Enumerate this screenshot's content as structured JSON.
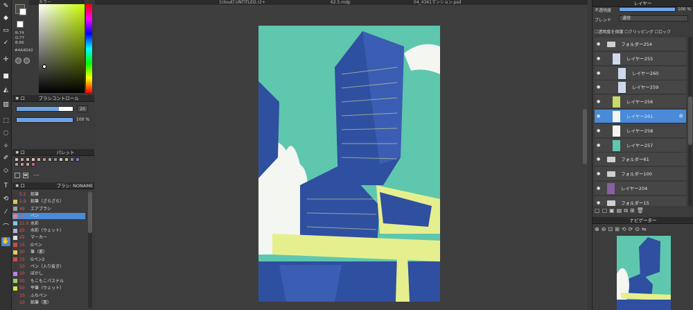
{
  "tabs": [
    "[cloud] UNTITLED.r2+",
    "62.5.mdp",
    "04_4341マンション.psd"
  ],
  "color_panel": {
    "title": "カラー",
    "r": "R:74",
    "g": "G:77",
    "b": "B:66",
    "hex": "#4A4D42"
  },
  "brush_control": {
    "title": "ブラシコントロール",
    "size": "20",
    "opacity": "100 %",
    "size_fill": 0.75,
    "opacity_fill": 1.0
  },
  "palette": {
    "title": "パレット",
    "count": "----",
    "swatches": [
      "#cfc7b6",
      "#b8a9a0",
      "#c9b0a0",
      "#d7c3b0",
      "#d2a9a8",
      "#b98f8f",
      "#a7a7b3",
      "#8e8ea3",
      "#c7c7c7",
      "#c4c46e",
      "#6f8fc1",
      "#7d7db3",
      "#a7a0a9",
      "#d08a8a",
      "#c9a080",
      "#c46090"
    ]
  },
  "brush_list": {
    "title": "ブラシ: NONAME",
    "items": [
      {
        "size": "5.2",
        "name": "鉛筆",
        "color": "#3a3a3a"
      },
      {
        "size": "1.9",
        "name": "鉛筆（ざらざら）",
        "color": "#d9c35a"
      },
      {
        "size": "49",
        "name": "エアブラシ",
        "color": "#a0a0a0"
      },
      {
        "size": "20",
        "name": "ペン",
        "color": "#e88080"
      },
      {
        "size": "11.0",
        "name": "水彩",
        "color": "#7cc9e6"
      },
      {
        "size": "20",
        "name": "水彩（ウェット）",
        "color": "#b0b0e0"
      },
      {
        "size": "25",
        "name": "マーカー",
        "color": "#e0e0e0"
      },
      {
        "size": "15",
        "name": "Gペン",
        "color": "#d04848"
      },
      {
        "size": "50",
        "name": "筆（悪）",
        "color": "#e6c95a"
      },
      {
        "size": "15",
        "name": "Gペン2",
        "color": "#d04848"
      },
      {
        "size": "10",
        "name": "ペン（入り抜き）",
        "color": "#3a3a3a"
      },
      {
        "size": "10",
        "name": "ぼかし",
        "color": "#c080e0"
      },
      {
        "size": "50",
        "name": "もこもこパステル",
        "color": "#a0d060"
      },
      {
        "size": "50",
        "name": "平筆（ウェット）",
        "color": "#e0e040"
      },
      {
        "size": "10",
        "name": "ふちペン",
        "color": "#3a3a3a"
      },
      {
        "size": "10",
        "name": "鉛筆（悪）",
        "color": "#3a3a3a"
      }
    ]
  },
  "layer_panel": {
    "title": "レイヤー",
    "opacity_label": "不透明度",
    "opacity_value": "100 %",
    "opacity_fill": 1.0,
    "blend_label": "ブレンド",
    "blend_value": "通常",
    "protect_alpha": "透明度を保護",
    "clipping": "クリッピング",
    "lock": "ロック",
    "layers": [
      {
        "name": "フォルダー254",
        "indent": 0,
        "type": "folder",
        "selected": false
      },
      {
        "name": "レイヤー255",
        "indent": 1,
        "type": "layer",
        "selected": false
      },
      {
        "name": "レイヤー260",
        "indent": 2,
        "type": "layer",
        "selected": false
      },
      {
        "name": "レイヤー259",
        "indent": 2,
        "type": "layer",
        "selected": false
      },
      {
        "name": "レイヤー256",
        "indent": 1,
        "type": "layer",
        "selected": false
      },
      {
        "name": "レイヤー261",
        "indent": 1,
        "type": "layer",
        "selected": true
      },
      {
        "name": "レイヤー258",
        "indent": 1,
        "type": "layer",
        "selected": false
      },
      {
        "name": "レイヤー257",
        "indent": 1,
        "type": "layer",
        "selected": false
      },
      {
        "name": "フォルダー61",
        "indent": 0,
        "type": "folder",
        "selected": false
      },
      {
        "name": "フォルダー100",
        "indent": 0,
        "type": "folder",
        "selected": false
      },
      {
        "name": "レイヤー204",
        "indent": 0,
        "type": "layer",
        "selected": false
      },
      {
        "name": "フォルダー15",
        "indent": 0,
        "type": "folder",
        "selected": false
      }
    ]
  },
  "navigator": {
    "title": "ナビゲーター"
  },
  "colors": {
    "accent": "#4a8ad8",
    "sky": "#5ec7ad",
    "building": "#2f4fa0",
    "highlight": "#e6ef8e"
  }
}
